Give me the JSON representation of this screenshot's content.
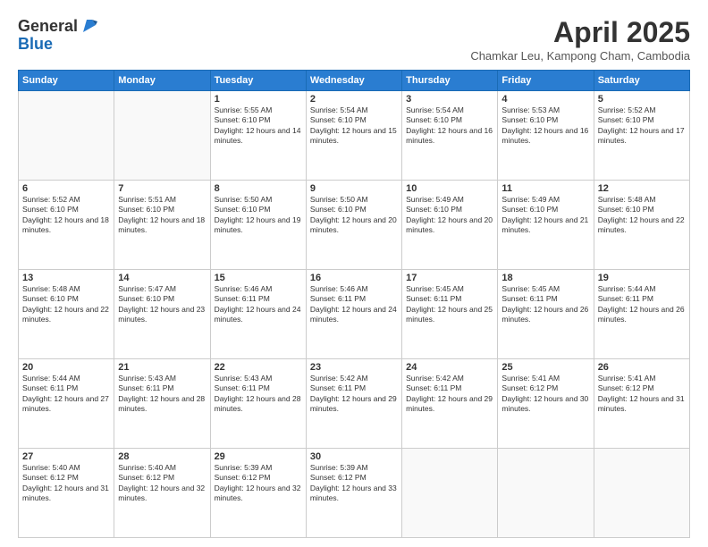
{
  "header": {
    "logo_general": "General",
    "logo_blue": "Blue",
    "title": "April 2025",
    "location": "Chamkar Leu, Kampong Cham, Cambodia"
  },
  "days_of_week": [
    "Sunday",
    "Monday",
    "Tuesday",
    "Wednesday",
    "Thursday",
    "Friday",
    "Saturday"
  ],
  "weeks": [
    [
      {
        "day": "",
        "sunrise": "",
        "sunset": "",
        "daylight": ""
      },
      {
        "day": "",
        "sunrise": "",
        "sunset": "",
        "daylight": ""
      },
      {
        "day": "1",
        "sunrise": "Sunrise: 5:55 AM",
        "sunset": "Sunset: 6:10 PM",
        "daylight": "Daylight: 12 hours and 14 minutes."
      },
      {
        "day": "2",
        "sunrise": "Sunrise: 5:54 AM",
        "sunset": "Sunset: 6:10 PM",
        "daylight": "Daylight: 12 hours and 15 minutes."
      },
      {
        "day": "3",
        "sunrise": "Sunrise: 5:54 AM",
        "sunset": "Sunset: 6:10 PM",
        "daylight": "Daylight: 12 hours and 16 minutes."
      },
      {
        "day": "4",
        "sunrise": "Sunrise: 5:53 AM",
        "sunset": "Sunset: 6:10 PM",
        "daylight": "Daylight: 12 hours and 16 minutes."
      },
      {
        "day": "5",
        "sunrise": "Sunrise: 5:52 AM",
        "sunset": "Sunset: 6:10 PM",
        "daylight": "Daylight: 12 hours and 17 minutes."
      }
    ],
    [
      {
        "day": "6",
        "sunrise": "Sunrise: 5:52 AM",
        "sunset": "Sunset: 6:10 PM",
        "daylight": "Daylight: 12 hours and 18 minutes."
      },
      {
        "day": "7",
        "sunrise": "Sunrise: 5:51 AM",
        "sunset": "Sunset: 6:10 PM",
        "daylight": "Daylight: 12 hours and 18 minutes."
      },
      {
        "day": "8",
        "sunrise": "Sunrise: 5:50 AM",
        "sunset": "Sunset: 6:10 PM",
        "daylight": "Daylight: 12 hours and 19 minutes."
      },
      {
        "day": "9",
        "sunrise": "Sunrise: 5:50 AM",
        "sunset": "Sunset: 6:10 PM",
        "daylight": "Daylight: 12 hours and 20 minutes."
      },
      {
        "day": "10",
        "sunrise": "Sunrise: 5:49 AM",
        "sunset": "Sunset: 6:10 PM",
        "daylight": "Daylight: 12 hours and 20 minutes."
      },
      {
        "day": "11",
        "sunrise": "Sunrise: 5:49 AM",
        "sunset": "Sunset: 6:10 PM",
        "daylight": "Daylight: 12 hours and 21 minutes."
      },
      {
        "day": "12",
        "sunrise": "Sunrise: 5:48 AM",
        "sunset": "Sunset: 6:10 PM",
        "daylight": "Daylight: 12 hours and 22 minutes."
      }
    ],
    [
      {
        "day": "13",
        "sunrise": "Sunrise: 5:48 AM",
        "sunset": "Sunset: 6:10 PM",
        "daylight": "Daylight: 12 hours and 22 minutes."
      },
      {
        "day": "14",
        "sunrise": "Sunrise: 5:47 AM",
        "sunset": "Sunset: 6:10 PM",
        "daylight": "Daylight: 12 hours and 23 minutes."
      },
      {
        "day": "15",
        "sunrise": "Sunrise: 5:46 AM",
        "sunset": "Sunset: 6:11 PM",
        "daylight": "Daylight: 12 hours and 24 minutes."
      },
      {
        "day": "16",
        "sunrise": "Sunrise: 5:46 AM",
        "sunset": "Sunset: 6:11 PM",
        "daylight": "Daylight: 12 hours and 24 minutes."
      },
      {
        "day": "17",
        "sunrise": "Sunrise: 5:45 AM",
        "sunset": "Sunset: 6:11 PM",
        "daylight": "Daylight: 12 hours and 25 minutes."
      },
      {
        "day": "18",
        "sunrise": "Sunrise: 5:45 AM",
        "sunset": "Sunset: 6:11 PM",
        "daylight": "Daylight: 12 hours and 26 minutes."
      },
      {
        "day": "19",
        "sunrise": "Sunrise: 5:44 AM",
        "sunset": "Sunset: 6:11 PM",
        "daylight": "Daylight: 12 hours and 26 minutes."
      }
    ],
    [
      {
        "day": "20",
        "sunrise": "Sunrise: 5:44 AM",
        "sunset": "Sunset: 6:11 PM",
        "daylight": "Daylight: 12 hours and 27 minutes."
      },
      {
        "day": "21",
        "sunrise": "Sunrise: 5:43 AM",
        "sunset": "Sunset: 6:11 PM",
        "daylight": "Daylight: 12 hours and 28 minutes."
      },
      {
        "day": "22",
        "sunrise": "Sunrise: 5:43 AM",
        "sunset": "Sunset: 6:11 PM",
        "daylight": "Daylight: 12 hours and 28 minutes."
      },
      {
        "day": "23",
        "sunrise": "Sunrise: 5:42 AM",
        "sunset": "Sunset: 6:11 PM",
        "daylight": "Daylight: 12 hours and 29 minutes."
      },
      {
        "day": "24",
        "sunrise": "Sunrise: 5:42 AM",
        "sunset": "Sunset: 6:11 PM",
        "daylight": "Daylight: 12 hours and 29 minutes."
      },
      {
        "day": "25",
        "sunrise": "Sunrise: 5:41 AM",
        "sunset": "Sunset: 6:12 PM",
        "daylight": "Daylight: 12 hours and 30 minutes."
      },
      {
        "day": "26",
        "sunrise": "Sunrise: 5:41 AM",
        "sunset": "Sunset: 6:12 PM",
        "daylight": "Daylight: 12 hours and 31 minutes."
      }
    ],
    [
      {
        "day": "27",
        "sunrise": "Sunrise: 5:40 AM",
        "sunset": "Sunset: 6:12 PM",
        "daylight": "Daylight: 12 hours and 31 minutes."
      },
      {
        "day": "28",
        "sunrise": "Sunrise: 5:40 AM",
        "sunset": "Sunset: 6:12 PM",
        "daylight": "Daylight: 12 hours and 32 minutes."
      },
      {
        "day": "29",
        "sunrise": "Sunrise: 5:39 AM",
        "sunset": "Sunset: 6:12 PM",
        "daylight": "Daylight: 12 hours and 32 minutes."
      },
      {
        "day": "30",
        "sunrise": "Sunrise: 5:39 AM",
        "sunset": "Sunset: 6:12 PM",
        "daylight": "Daylight: 12 hours and 33 minutes."
      },
      {
        "day": "",
        "sunrise": "",
        "sunset": "",
        "daylight": ""
      },
      {
        "day": "",
        "sunrise": "",
        "sunset": "",
        "daylight": ""
      },
      {
        "day": "",
        "sunrise": "",
        "sunset": "",
        "daylight": ""
      }
    ]
  ]
}
